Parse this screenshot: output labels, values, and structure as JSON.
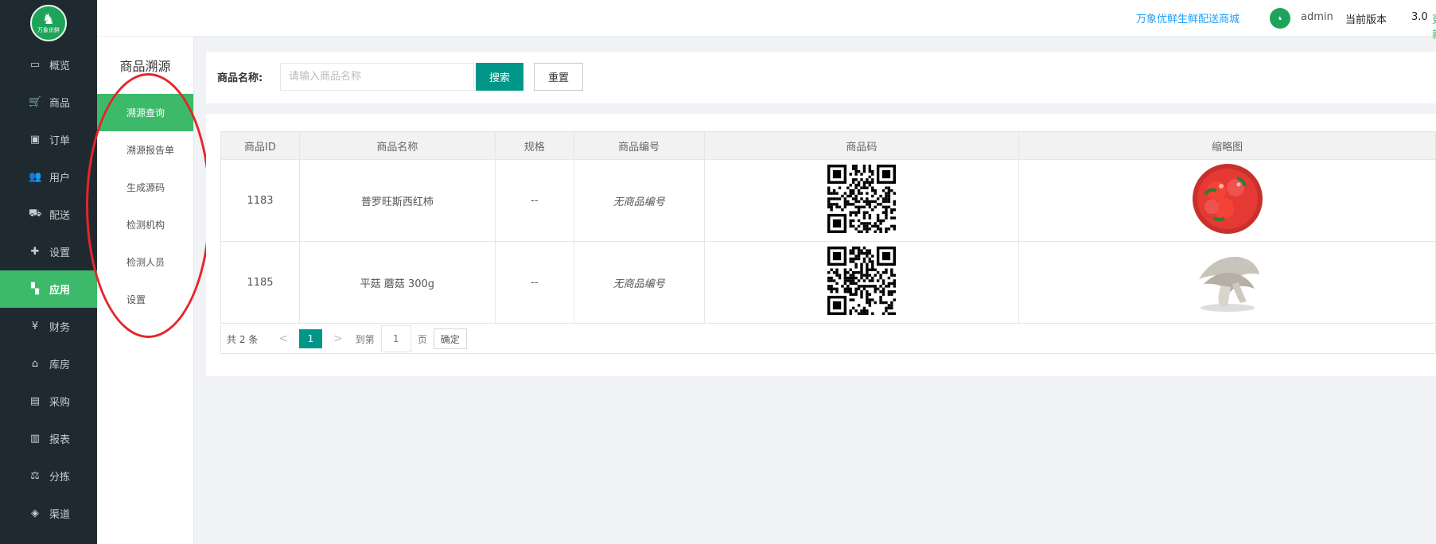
{
  "app": {
    "logo_text": "万象优鲜",
    "brand_link": "万象优鲜生鲜配送商城",
    "user": "admin",
    "version_label": "当前版本",
    "version_number": "3.0",
    "update_label": "更新"
  },
  "sidebar": {
    "items": [
      {
        "label": "概览",
        "icon": "monitor-icon"
      },
      {
        "label": "商品",
        "icon": "cart-icon"
      },
      {
        "label": "订单",
        "icon": "money-icon"
      },
      {
        "label": "用户",
        "icon": "users-icon"
      },
      {
        "label": "配送",
        "icon": "truck-icon"
      },
      {
        "label": "设置",
        "icon": "puzzle-icon"
      },
      {
        "label": "应用",
        "icon": "grid-icon",
        "active": true
      },
      {
        "label": "财务",
        "icon": "yen-icon"
      },
      {
        "label": "库房",
        "icon": "home-icon"
      },
      {
        "label": "采购",
        "icon": "bus-icon"
      },
      {
        "label": "报表",
        "icon": "bar-chart-icon"
      },
      {
        "label": "分拣",
        "icon": "scale-icon"
      },
      {
        "label": "渠道",
        "icon": "box-icon"
      }
    ]
  },
  "submenu": {
    "title": "商品溯源",
    "items": [
      {
        "label": "溯源查询",
        "active": true
      },
      {
        "label": "溯源报告单"
      },
      {
        "label": "生成源码"
      },
      {
        "label": "检测机构"
      },
      {
        "label": "检测人员"
      },
      {
        "label": "设置"
      }
    ]
  },
  "search": {
    "label": "商品名称:",
    "placeholder": "请输入商品名称",
    "value": "",
    "search_button": "搜索",
    "reset_button": "重置"
  },
  "table": {
    "headers": [
      "商品ID",
      "商品名称",
      "规格",
      "商品编号",
      "商品码",
      "缩略图"
    ],
    "rows": [
      {
        "id": "1183",
        "name": "普罗旺斯西红柿",
        "spec": "--",
        "code": "无商品编号",
        "thumb": "tomato"
      },
      {
        "id": "1185",
        "name": "平菇 蘑菇 300g",
        "spec": "--",
        "code": "无商品编号",
        "thumb": "mushroom"
      }
    ]
  },
  "pagination": {
    "total": "共 2 条",
    "current": "1",
    "goto_label": "到第",
    "goto_value": "1",
    "page_label": "页",
    "confirm": "确定"
  },
  "colors": {
    "sidebar_bg": "#1f2a30",
    "accent_green": "#3cba6a",
    "button_teal": "#009688",
    "link_blue": "#1e9fff",
    "annotation_red": "#e5252a"
  }
}
